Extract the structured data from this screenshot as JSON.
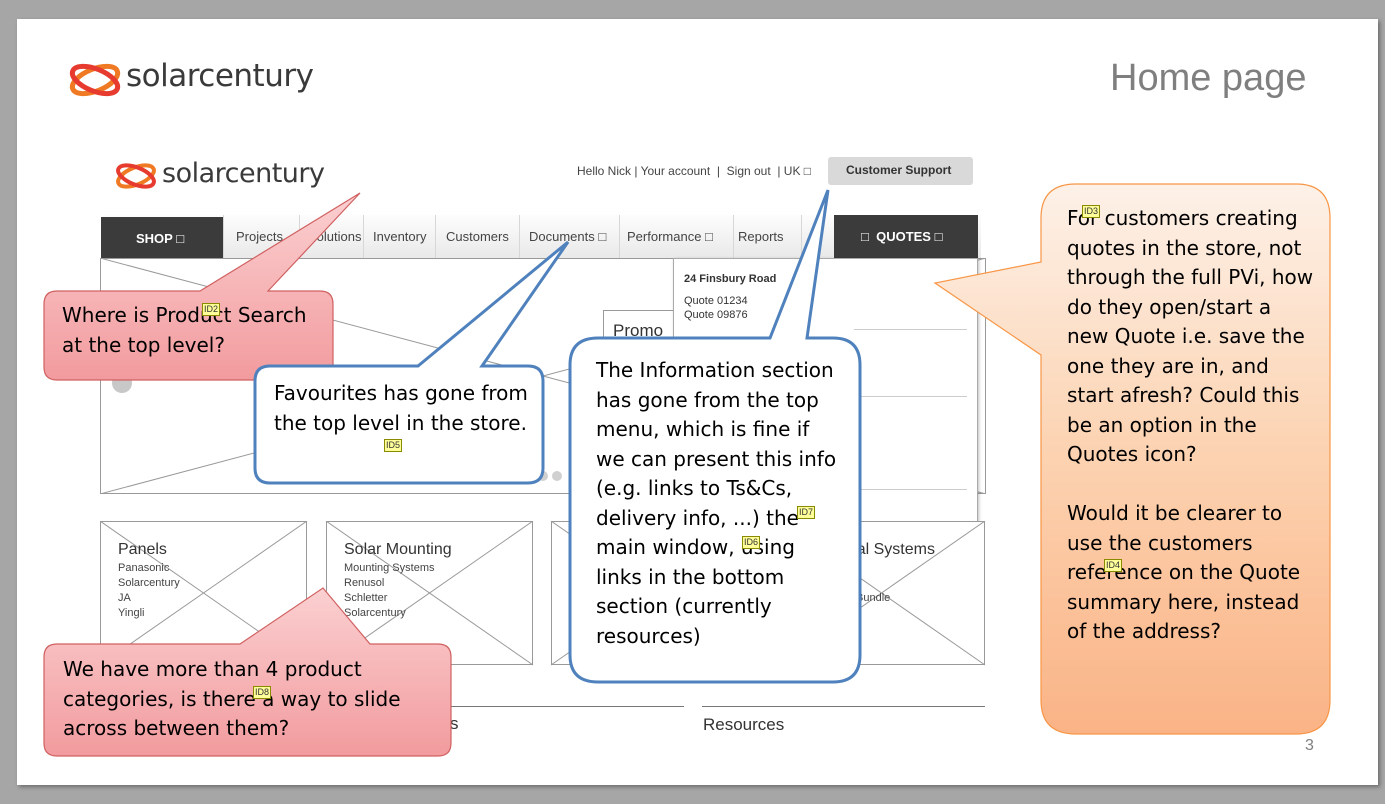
{
  "slide": {
    "title": "Home page",
    "page_number": "3",
    "brand": "solarcentury"
  },
  "site": {
    "brand": "solarcentury",
    "header_links": "Hello Nick | Your account  |  Sign out  | UK □",
    "support_button": "Customer Support",
    "nav": {
      "shop": "SHOP □",
      "items": [
        "Projects",
        "Solutions",
        "Inventory",
        "Customers",
        "Documents □",
        "Performance □",
        "Reports"
      ],
      "quotes": "□  QUOTES □"
    },
    "quote_dropdown": {
      "address": "24 Finsbury Road",
      "quote1": "Quote 01234",
      "quote2": "Quote 09876"
    },
    "promo_label": "Promo",
    "categories": [
      {
        "title": "Panels",
        "items": [
          "Panasonic",
          "Solarcentury",
          "JA",
          "Yingli"
        ]
      },
      {
        "title": "Solar Mounting",
        "items": [
          "Mounting Systems",
          "Renusol",
          "Schletter",
          "Solarcentury"
        ]
      },
      {
        "title": "",
        "items": []
      },
      {
        "title": "Residential Systems",
        "items": [
          "",
          "",
          "Bundle"
        ]
      }
    ],
    "bottom": {
      "left_fragment": "s",
      "resources": "Resources"
    }
  },
  "callouts": {
    "product_search": {
      "text": "Where is Product Search at the top level?",
      "tag": "ID2"
    },
    "favourites": {
      "text": "Favourites has gone from the top level in the store.",
      "tag": "ID5"
    },
    "information": {
      "text": "The Information section has gone from the top menu, which is fine if we can present this info (e.g. links to Ts&Cs, delivery info, ...) the main window, using links in the bottom section (currently resources)",
      "tag1": "ID7",
      "tag2": "ID6"
    },
    "quotes": {
      "text": "For customers creating quotes in the store, not through the full PVi, how do they open/start a new Quote i.e. save the one they are in, and start afresh? Could this be an option in the Quotes icon?",
      "tag": "ID3",
      "text2": "Would it be clearer to use the customers reference on the Quote summary here, instead of the address?",
      "tag2": "ID4"
    },
    "categories": {
      "text": "We have more than 4 product categories, is there a way to slide across between them?",
      "tag": "ID8"
    }
  },
  "colors": {
    "pink": "#f4a7a9",
    "blue_border": "#4f81bd",
    "orange_top": "#fde9d9",
    "orange_bottom": "#fabf8f",
    "logo_orange": "#f07a23",
    "logo_red": "#e63b2e"
  }
}
